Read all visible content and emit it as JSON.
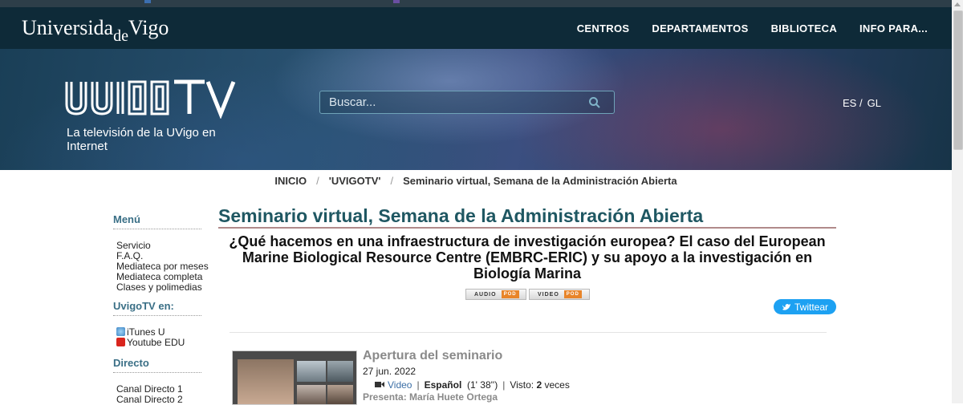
{
  "header": {
    "logo_main": "Universida",
    "logo_de": "de",
    "logo_end": "Vigo",
    "nav": [
      "CENTROS",
      "DEPARTAMENTOS",
      "BIBLIOTECA",
      "INFO PARA..."
    ]
  },
  "hero": {
    "tagline": "La televisión de la UVigo en Internet",
    "search_placeholder": "Buscar...",
    "lang_es": "ES /",
    "lang_gl": "GL"
  },
  "breadcrumb": {
    "items": [
      "INICIO",
      "'UVIGOTV'",
      "Seminario virtual, Semana de la Administración Abierta"
    ],
    "separator": "/"
  },
  "sidebar": {
    "menu_title": "Menú",
    "menu_items": [
      "Servicio",
      "F.A.Q.",
      "Mediateca por meses",
      "Mediateca completa",
      "Clases y polimedias"
    ],
    "uvigotv_title": "UvigoTV en:",
    "uvigotv_items": [
      "iTunes U",
      "Youtube EDU"
    ],
    "directo_title": "Directo",
    "directo_items": [
      "Canal Directo 1",
      "Canal Directo 2"
    ]
  },
  "content": {
    "title": "Seminario virtual, Semana de la Administración Abierta",
    "subtitle": "¿Qué hacemos en una infraestructura de investigación europea? El caso del European Marine Biological Resource Centre (EMBRC-ERIC) y su apoyo a la investigación en Biología Marina",
    "audio_label": "AUDIO",
    "video_label": "VIDEO",
    "pod_label": "POD",
    "tweet_label": "Twittear",
    "item": {
      "title": "Apertura del seminario",
      "date": "27 jun. 2022",
      "type": "Video",
      "language": "Español",
      "duration": "(1' 38'')",
      "views_label": "Visto:",
      "views_count": "2",
      "views_unit": "veces",
      "presenter": "Presenta: María Huete Ortega"
    }
  },
  "colors": {
    "navbar": "#0e2a38",
    "title": "#1f5762",
    "sidebar_heading": "#3a6f86",
    "twitter": "#1da1f2",
    "pod": "#e8852a"
  }
}
